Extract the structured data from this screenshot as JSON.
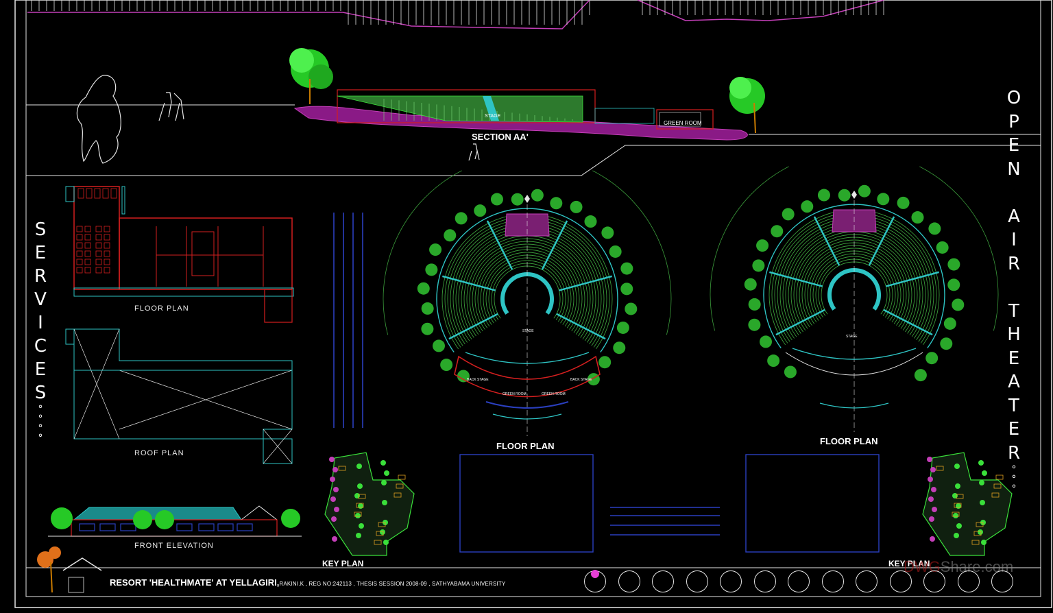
{
  "drawing": {
    "section_label": "SECTION AA'",
    "section_stage": "STAGE",
    "section_green_room": "GREEN ROOM",
    "services_floor_plan": "FLOOR PLAN",
    "services_roof_plan": "ROOF PLAN",
    "services_front_elevation": "FRONT ELEVATION",
    "theater_floor_plan_1": "FLOOR PLAN",
    "theater_floor_plan_2": "FLOOR PLAN",
    "theater_stage_label": "STAGE",
    "back_stage_left": "BACK STAGE",
    "back_stage_right": "BACK STAGE",
    "green_room_left": "GREEN ROOM",
    "green_room_right": "GREEN ROOM",
    "key_plan_1": "KEY PLAN",
    "key_plan_2": "KEY PLAN"
  },
  "side_titles": {
    "services_letters": [
      "S",
      "E",
      "R",
      "V",
      "I",
      "C",
      "E",
      "S",
      "°",
      "°",
      "°",
      "°"
    ],
    "open_air_letters": [
      "O",
      "P",
      "E",
      "N",
      "",
      "A",
      "I",
      "R",
      "",
      "T",
      "H",
      "E",
      "A",
      "T",
      "E",
      "R",
      "°",
      "°",
      "°"
    ]
  },
  "title_block": {
    "title": "RESORT 'HEALTHMATE' AT YELLAGIRI,",
    "subtitle": "RAKINI.K , REG NO:242113 , THESIS SESSION 2008-09 , SATHYABAMA UNIVERSITY"
  },
  "watermark": {
    "prefix": "DWG",
    "suffix": "Share.com"
  },
  "sheet_navigator": {
    "count": 13,
    "active_index": 0
  },
  "colors": {
    "background": "#000000",
    "line_white": "#e6e6e6",
    "cyan": "#2ec4c4",
    "green": "#3adf3a",
    "magenta": "#c43fb8",
    "red": "#d41f1f",
    "blue": "#2a3fbf",
    "accent_pink": "#e83fd6"
  }
}
